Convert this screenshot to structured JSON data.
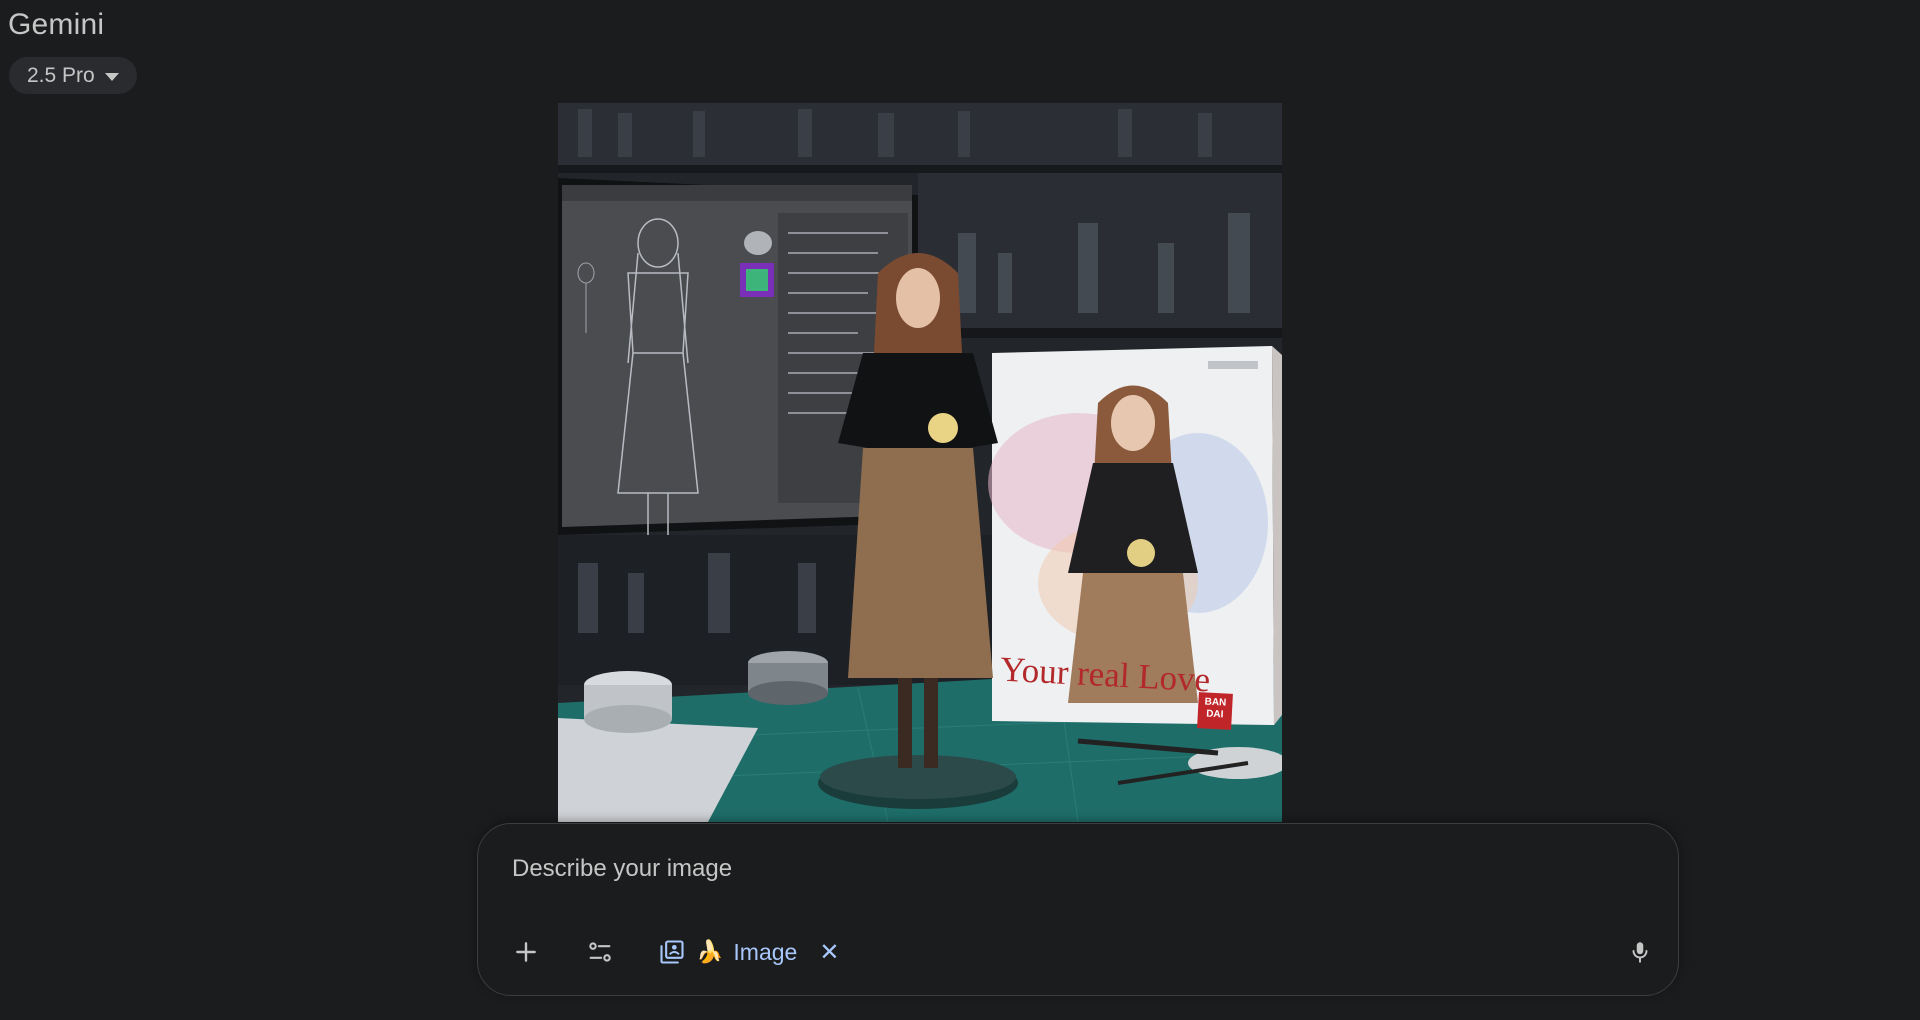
{
  "app": {
    "title": "Gemini"
  },
  "model_selector": {
    "value": "2.5 Pro"
  },
  "preview_image": {
    "box_text": "Your real Love",
    "brand_text": "BAN\nDAI"
  },
  "prompt": {
    "placeholder": "Describe your image",
    "value": "",
    "chip": {
      "emoji": "🍌",
      "label": "Image",
      "close": "✕"
    }
  },
  "icons": {
    "add": "plus-icon",
    "tools": "tools-sliders-icon",
    "image_mode": "image-gallery-icon",
    "voice": "microphone-icon",
    "dropdown": "chevron-down-icon"
  }
}
